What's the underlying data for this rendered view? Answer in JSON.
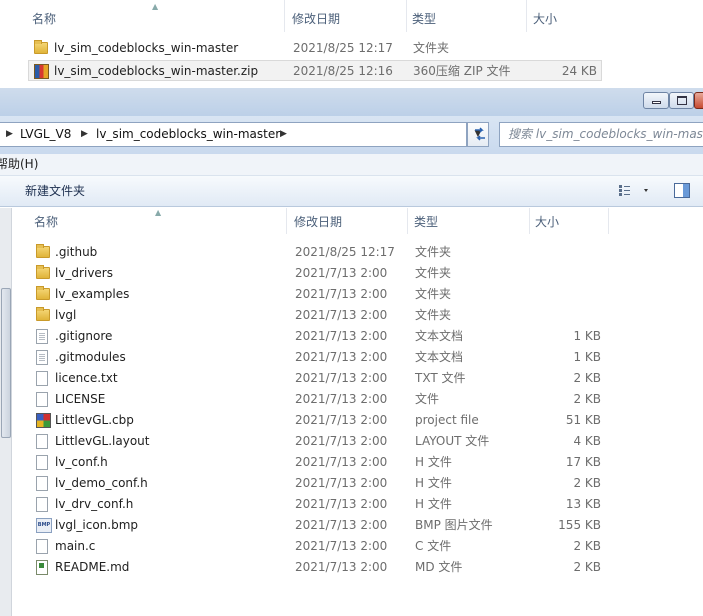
{
  "top_window": {
    "columns": {
      "name": "名称",
      "date": "修改日期",
      "type": "类型",
      "size": "大小"
    },
    "rows": [
      {
        "name": "lv_sim_codeblocks_win-master",
        "date": "2021/8/25 12:17",
        "type": "文件夹",
        "size": "",
        "icon": "folder-icon"
      },
      {
        "name": "lv_sim_codeblocks_win-master.zip",
        "date": "2021/8/25 12:16",
        "type": "360压缩 ZIP 文件",
        "size": "24 KB",
        "icon": "zip-icon"
      }
    ]
  },
  "main_window": {
    "breadcrumb": [
      "LVGL_V8",
      "lv_sim_codeblocks_win-master"
    ],
    "search_placeholder": "搜索 lv_sim_codeblocks_win-master",
    "menu": {
      "help": "帮助(H)"
    },
    "toolbar": {
      "new_folder": "新建文件夹"
    },
    "columns": {
      "name": "名称",
      "date": "修改日期",
      "type": "类型",
      "size": "大小"
    },
    "files": [
      {
        "name": ".github",
        "date": "2021/8/25 12:17",
        "type": "文件夹",
        "size": "",
        "icon": "folder-icon"
      },
      {
        "name": "lv_drivers",
        "date": "2021/7/13 2:00",
        "type": "文件夹",
        "size": "",
        "icon": "folder-icon"
      },
      {
        "name": "lv_examples",
        "date": "2021/7/13 2:00",
        "type": "文件夹",
        "size": "",
        "icon": "folder-icon"
      },
      {
        "name": "lvgl",
        "date": "2021/7/13 2:00",
        "type": "文件夹",
        "size": "",
        "icon": "folder-icon"
      },
      {
        "name": ".gitignore",
        "date": "2021/7/13 2:00",
        "type": "文本文档",
        "size": "1 KB",
        "icon": "text-document-icon"
      },
      {
        "name": ".gitmodules",
        "date": "2021/7/13 2:00",
        "type": "文本文档",
        "size": "1 KB",
        "icon": "text-document-icon"
      },
      {
        "name": "licence.txt",
        "date": "2021/7/13 2:00",
        "type": "TXT 文件",
        "size": "2 KB",
        "icon": "document-icon"
      },
      {
        "name": "LICENSE",
        "date": "2021/7/13 2:00",
        "type": "文件",
        "size": "2 KB",
        "icon": "document-icon"
      },
      {
        "name": "LittlevGL.cbp",
        "date": "2021/7/13 2:00",
        "type": "project file",
        "size": "51 KB",
        "icon": "codeblocks-project-icon"
      },
      {
        "name": "LittlevGL.layout",
        "date": "2021/7/13 2:00",
        "type": "LAYOUT 文件",
        "size": "4 KB",
        "icon": "document-icon"
      },
      {
        "name": "lv_conf.h",
        "date": "2021/7/13 2:00",
        "type": "H 文件",
        "size": "17 KB",
        "icon": "document-icon"
      },
      {
        "name": "lv_demo_conf.h",
        "date": "2021/7/13 2:00",
        "type": "H 文件",
        "size": "2 KB",
        "icon": "document-icon"
      },
      {
        "name": "lv_drv_conf.h",
        "date": "2021/7/13 2:00",
        "type": "H 文件",
        "size": "13 KB",
        "icon": "document-icon"
      },
      {
        "name": "lvgl_icon.bmp",
        "date": "2021/7/13 2:00",
        "type": "BMP 图片文件",
        "size": "155 KB",
        "icon": "bmp-image-icon"
      },
      {
        "name": "main.c",
        "date": "2021/7/13 2:00",
        "type": "C 文件",
        "size": "2 KB",
        "icon": "document-icon"
      },
      {
        "name": "README.md",
        "date": "2021/7/13 2:00",
        "type": "MD 文件",
        "size": "2 KB",
        "icon": "readme-icon"
      }
    ]
  }
}
